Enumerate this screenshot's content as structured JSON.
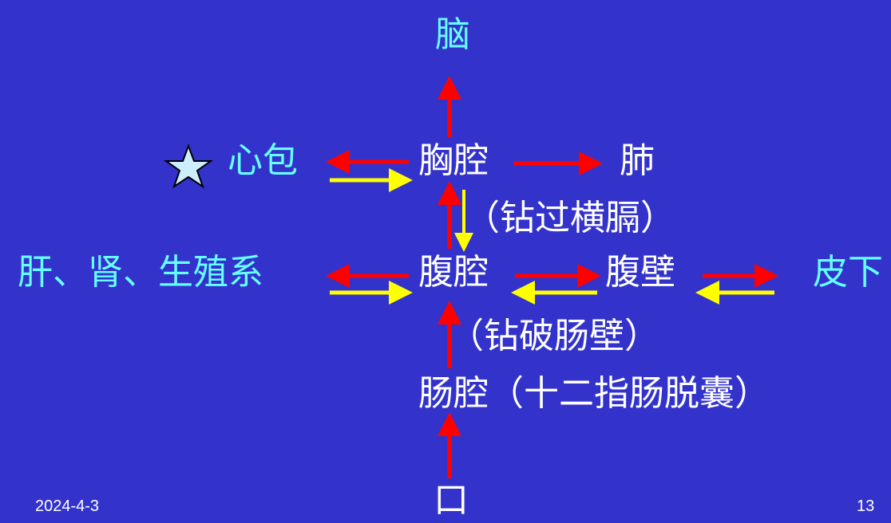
{
  "nodes": {
    "brain": "脑",
    "pericardium": "心包",
    "thoracic": "胸腔",
    "lung": "肺",
    "via_diaphragm": "（钻过横膈）",
    "organs": "肝、肾、生殖系",
    "abdominal": "腹腔",
    "abdominal_wall": "腹壁",
    "subcutaneous": "皮下",
    "via_intestinal_wall": "（钻破肠壁）",
    "intestinal": "肠腔（十二指肠脱囊）",
    "mouth": "口"
  },
  "footer": {
    "date": "2024-4-3",
    "page": "13"
  },
  "colors": {
    "background": "#3333CC",
    "arrow_red": "#FF0000",
    "arrow_yellow": "#FFFF00",
    "text_white": "#FFFFFF",
    "text_cyan": "#66FFFF",
    "star": "#CCEEFF"
  }
}
